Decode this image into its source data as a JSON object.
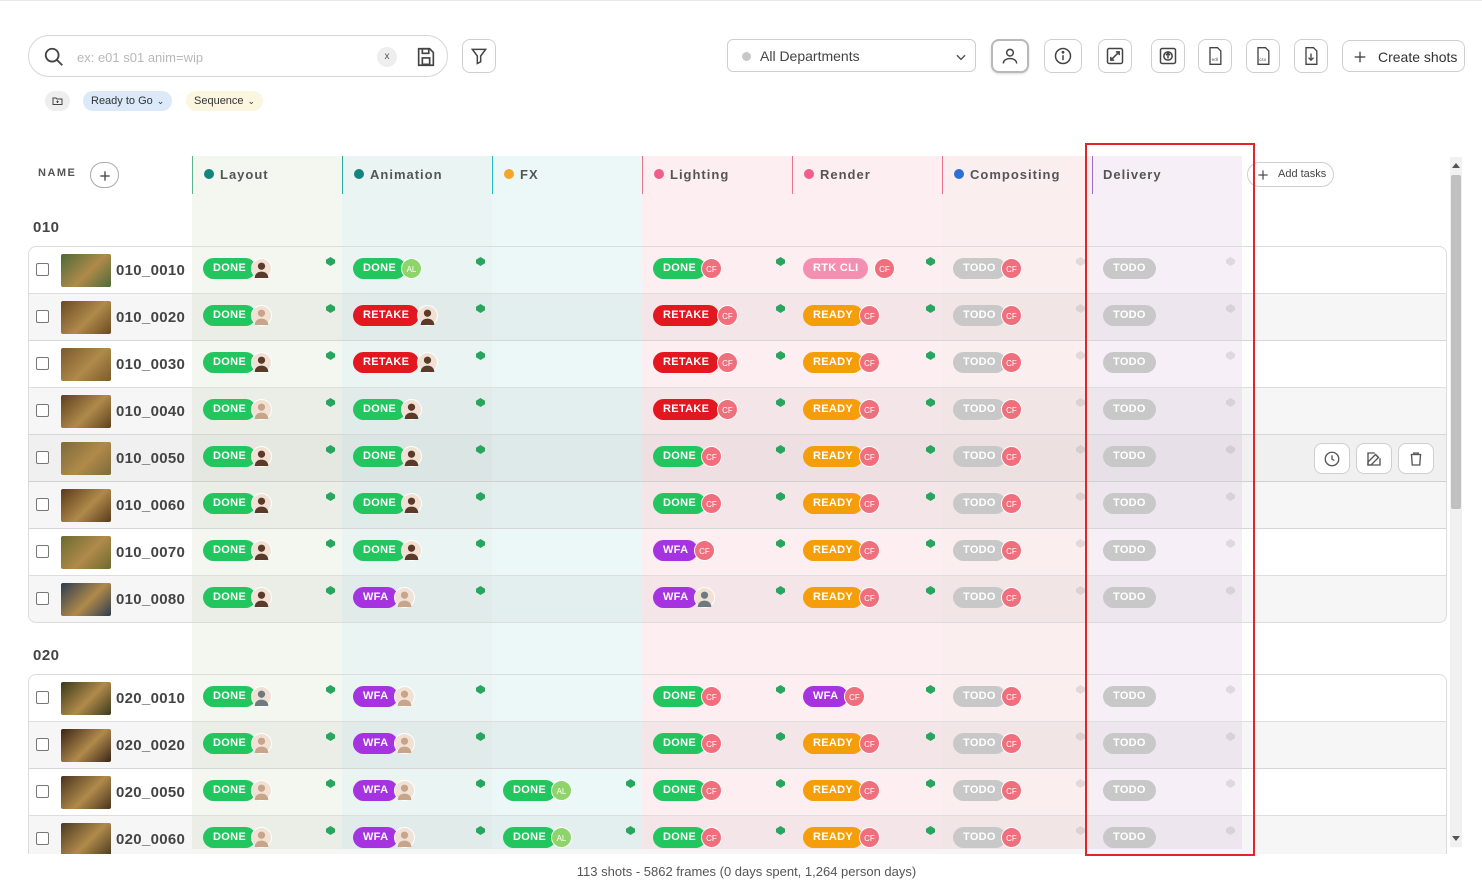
{
  "search": {
    "placeholder": "ex: e01 s01 anim=wip",
    "clear_label": "x"
  },
  "department_select": {
    "value": "All Departments"
  },
  "create_button": {
    "label": "Create shots"
  },
  "filter_chips": [
    {
      "label": "Ready to Go",
      "color": "#dbe9f8"
    },
    {
      "label": "Sequence",
      "color": "#fbf6df"
    }
  ],
  "table": {
    "name_header": "NAME",
    "add_tasks_label": "Add tasks",
    "columns": [
      {
        "label": "Layout",
        "dot_color": "#12857c",
        "line_color": "#5db38d",
        "bg": "#f3f7ef"
      },
      {
        "label": "Animation",
        "dot_color": "#14857e",
        "line_color": "#2ea89c",
        "bg": "#e9f4f3"
      },
      {
        "label": "FX",
        "dot_color": "#f5a52a",
        "line_color": "#27b8c0",
        "bg": "#ecf8f8"
      },
      {
        "label": "Lighting",
        "dot_color": "#ef5e8e",
        "line_color": "#e8738c",
        "bg": "#fdeef1"
      },
      {
        "label": "Render",
        "dot_color": "#ef5e8e",
        "line_color": "#e8738c",
        "bg": "#fdeef1"
      },
      {
        "label": "Compositing",
        "dot_color": "#2e6fd6",
        "line_color": "#e8738c",
        "bg": "#fbeeef"
      },
      {
        "label": "Delivery",
        "dot_color": "",
        "line_color": "#a06cc7",
        "bg": "#f6eff7"
      }
    ]
  },
  "status_colors": {
    "DONE": "#22c55e",
    "RETAKE": "#e2171f",
    "READY": "#f59e0b",
    "RTK CLI": "#f48fb1",
    "WFA": "#a633e0",
    "TODO": "#c8c8c8"
  },
  "sequences": [
    {
      "name": "010",
      "shots": [
        {
          "name": "010_0010",
          "thumb": "#4c6a3a",
          "tasks": [
            [
              "DONE",
              "person"
            ],
            [
              "DONE",
              "AL"
            ],
            null,
            [
              "DONE",
              "CF"
            ],
            [
              "RTK CLI",
              "CF"
            ],
            [
              "TODO",
              "CF"
            ],
            [
              "TODO",
              ""
            ]
          ]
        },
        {
          "name": "010_0020",
          "thumb": "#6a4a24",
          "tasks": [
            [
              "DONE",
              "person2"
            ],
            [
              "RETAKE",
              "person"
            ],
            null,
            [
              "RETAKE",
              "CF"
            ],
            [
              "READY",
              "CF"
            ],
            [
              "TODO",
              "CF"
            ],
            [
              "TODO",
              ""
            ]
          ]
        },
        {
          "name": "010_0030",
          "thumb": "#7a5a2e",
          "tasks": [
            [
              "DONE",
              "person"
            ],
            [
              "RETAKE",
              "person"
            ],
            null,
            [
              "RETAKE",
              "CF"
            ],
            [
              "READY",
              "CF"
            ],
            [
              "TODO",
              "CF"
            ],
            [
              "TODO",
              ""
            ]
          ]
        },
        {
          "name": "010_0040",
          "thumb": "#5e4020",
          "tasks": [
            [
              "DONE",
              "person2"
            ],
            [
              "DONE",
              "person"
            ],
            null,
            [
              "RETAKE",
              "CF"
            ],
            [
              "READY",
              "CF"
            ],
            [
              "TODO",
              "CF"
            ],
            [
              "TODO",
              ""
            ]
          ]
        },
        {
          "name": "010_0050",
          "thumb": "#7d6a3a",
          "tasks": [
            [
              "DONE",
              "person"
            ],
            [
              "DONE",
              "person"
            ],
            null,
            [
              "DONE",
              "CF"
            ],
            [
              "READY",
              "CF"
            ],
            [
              "TODO",
              "CF"
            ],
            [
              "TODO",
              ""
            ]
          ]
        },
        {
          "name": "010_0060",
          "thumb": "#5a3a1c",
          "tasks": [
            [
              "DONE",
              "person"
            ],
            [
              "DONE",
              "person"
            ],
            null,
            [
              "DONE",
              "CF"
            ],
            [
              "READY",
              "CF"
            ],
            [
              "TODO",
              "CF"
            ],
            [
              "TODO",
              ""
            ]
          ]
        },
        {
          "name": "010_0070",
          "thumb": "#6c6a30",
          "tasks": [
            [
              "DONE",
              "person"
            ],
            [
              "DONE",
              "person"
            ],
            null,
            [
              "WFA",
              "CF"
            ],
            [
              "READY",
              "CF"
            ],
            [
              "TODO",
              "CF"
            ],
            [
              "TODO",
              ""
            ]
          ]
        },
        {
          "name": "010_0080",
          "thumb": "#2c3c50",
          "tasks": [
            [
              "DONE",
              "person"
            ],
            [
              "WFA",
              "person2"
            ],
            null,
            [
              "WFA",
              "person3"
            ],
            [
              "READY",
              "CF"
            ],
            [
              "TODO",
              "CF"
            ],
            [
              "TODO",
              ""
            ]
          ]
        }
      ]
    },
    {
      "name": "020",
      "shots": [
        {
          "name": "020_0010",
          "thumb": "#3a3a1c",
          "tasks": [
            [
              "DONE",
              "person3"
            ],
            [
              "WFA",
              "person2"
            ],
            null,
            [
              "DONE",
              "CF"
            ],
            [
              "WFA",
              "CF"
            ],
            [
              "TODO",
              "CF"
            ],
            [
              "TODO",
              ""
            ]
          ]
        },
        {
          "name": "020_0020",
          "thumb": "#3a2418",
          "tasks": [
            [
              "DONE",
              "person2"
            ],
            [
              "WFA",
              "person2"
            ],
            null,
            [
              "DONE",
              "CF"
            ],
            [
              "READY",
              "CF"
            ],
            [
              "TODO",
              "CF"
            ],
            [
              "TODO",
              ""
            ]
          ]
        },
        {
          "name": "020_0050",
          "thumb": "#4a3420",
          "tasks": [
            [
              "DONE",
              "person2"
            ],
            [
              "WFA",
              "person2"
            ],
            [
              "DONE",
              "AL"
            ],
            [
              "DONE",
              "CF"
            ],
            [
              "READY",
              "CF"
            ],
            [
              "TODO",
              "CF"
            ],
            [
              "TODO",
              ""
            ]
          ]
        },
        {
          "name": "020_0060",
          "thumb": "#4a3a22",
          "tasks": [
            [
              "DONE",
              "person2"
            ],
            [
              "WFA",
              "person2"
            ],
            [
              "DONE",
              "AL"
            ],
            [
              "DONE",
              "CF"
            ],
            [
              "READY",
              "CF"
            ],
            [
              "TODO",
              "CF"
            ],
            [
              "TODO",
              ""
            ]
          ]
        }
      ]
    }
  ],
  "footer": {
    "summary": "113 shots - 5862 frames (0 days spent, 1,264 person days)"
  }
}
